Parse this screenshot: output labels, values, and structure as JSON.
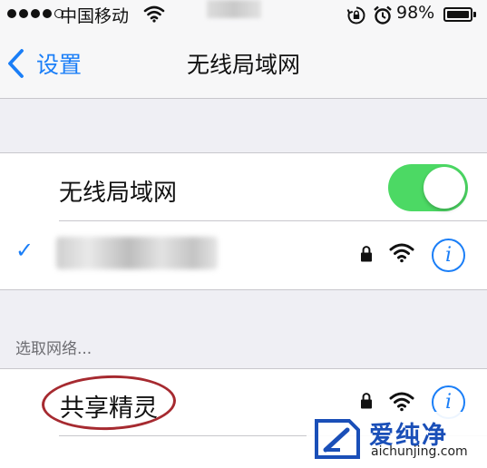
{
  "status_bar": {
    "carrier": "中国移动",
    "battery_percent": "98%",
    "battery_level": 0.98,
    "signal_bars_filled": 4,
    "signal_bars_total": 5
  },
  "nav": {
    "back_label": "设置",
    "title": "无线局域网"
  },
  "wifi_toggle": {
    "label": "无线局域网",
    "on": true,
    "on_color": "#4cd964"
  },
  "connected_network": {
    "name_hidden": true,
    "secured": true
  },
  "section_header": "选取网络...",
  "networks": [
    {
      "name": "共享精灵",
      "secured": true,
      "highlighted": true
    }
  ],
  "watermark": {
    "text_cn": "爱纯净",
    "text_en": "aichunjing.com"
  },
  "colors": {
    "accent": "#1a7ef7",
    "toggle_on": "#4cd964",
    "highlight_oval": "#a62a30"
  },
  "icons": [
    "signal-dots-icon",
    "wifi-icon",
    "orientation-lock-icon",
    "alarm-icon",
    "battery-icon",
    "back-chevron-icon",
    "checkmark-icon",
    "lock-icon",
    "info-icon"
  ]
}
